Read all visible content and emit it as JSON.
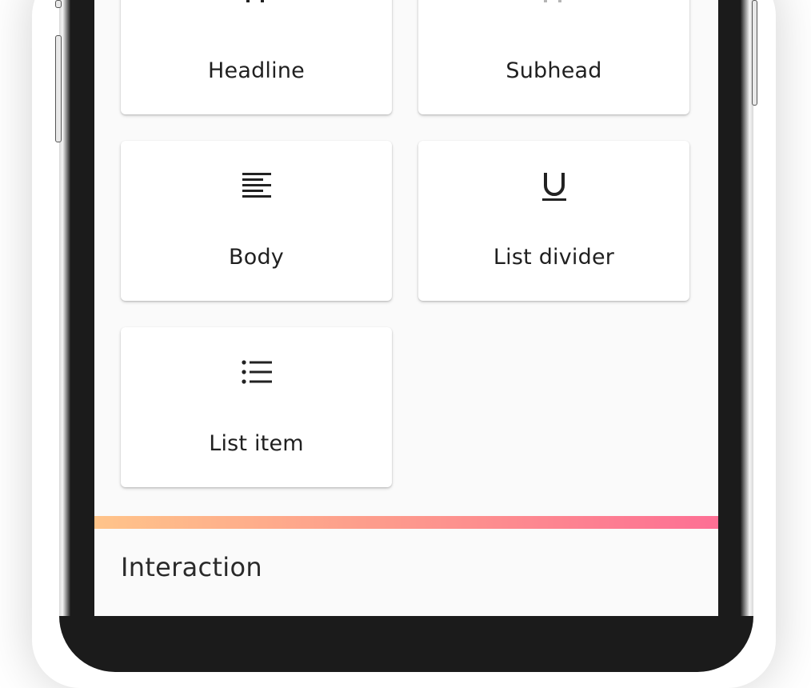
{
  "cards": [
    {
      "label": "Headline",
      "icon": "text-fields-icon"
    },
    {
      "label": "Subhead",
      "icon": "text-fields-icon"
    },
    {
      "label": "Body",
      "icon": "text-align-left-icon"
    },
    {
      "label": "List divider",
      "icon": "underline-icon"
    },
    {
      "label": "List item",
      "icon": "list-bulleted-icon"
    }
  ],
  "section": {
    "title": "Interaction"
  },
  "colors": {
    "gradient_start": "#ffc48a",
    "gradient_end": "#fd6f94",
    "screen_bg": "#fafafa",
    "card_bg": "#ffffff"
  }
}
